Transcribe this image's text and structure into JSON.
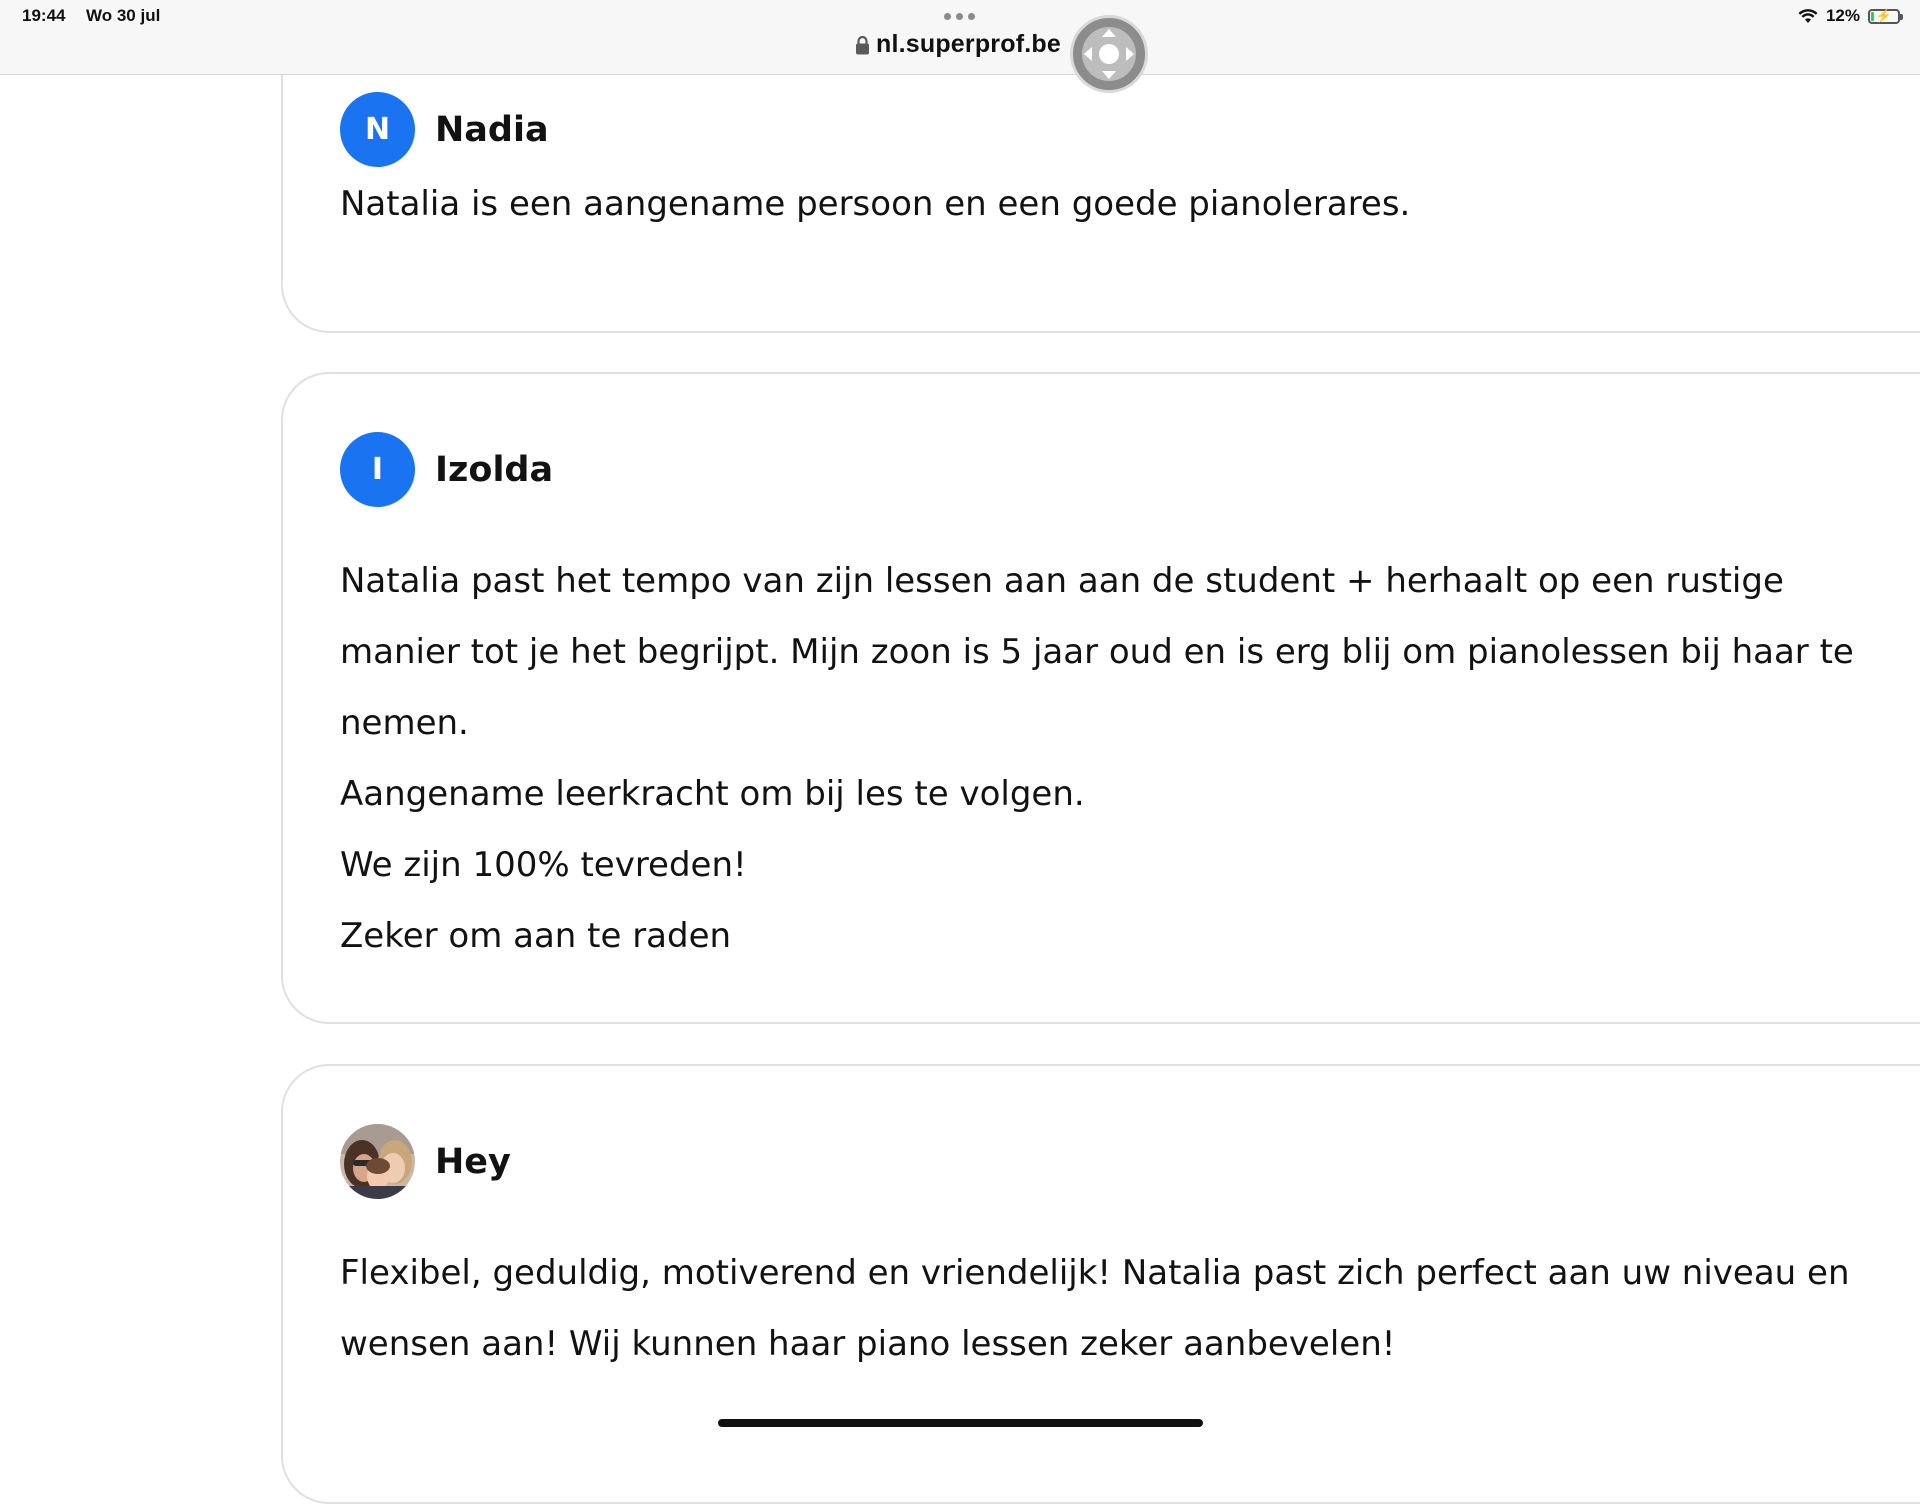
{
  "status_bar": {
    "time": "19:44",
    "date": "Wo 30 jul",
    "battery": "12%",
    "battery_level": 0.12
  },
  "browser": {
    "url": "nl.superprof.be"
  },
  "reviews": [
    {
      "initial": "N",
      "name": "Nadia",
      "lines": [
        "Natalia is een aangename persoon en een goede pianolerares."
      ]
    },
    {
      "initial": "I",
      "name": "Izolda",
      "lines": [
        "Natalia past het tempo van zijn lessen aan aan de student + herhaalt op een rustige",
        "manier tot je het begrijpt. Mijn zoon is 5 jaar oud en is erg blij om pianolessen bij haar te",
        "nemen.",
        "Aangename leerkracht om bij les te volgen.",
        "We zijn 100% tevreden!",
        "Zeker om aan te raden"
      ]
    },
    {
      "name": "Hey",
      "lines": [
        "Flexibel, geduldig, motiverend en vriendelijk! Natalia past zich perfect aan uw niveau en",
        "wensen aan! Wij kunnen haar piano lessen zeker aanbevelen!"
      ]
    }
  ],
  "colors": {
    "avatar_blue": "#1a73f0",
    "text": "#121212",
    "card_border": "#e0e0e0"
  }
}
